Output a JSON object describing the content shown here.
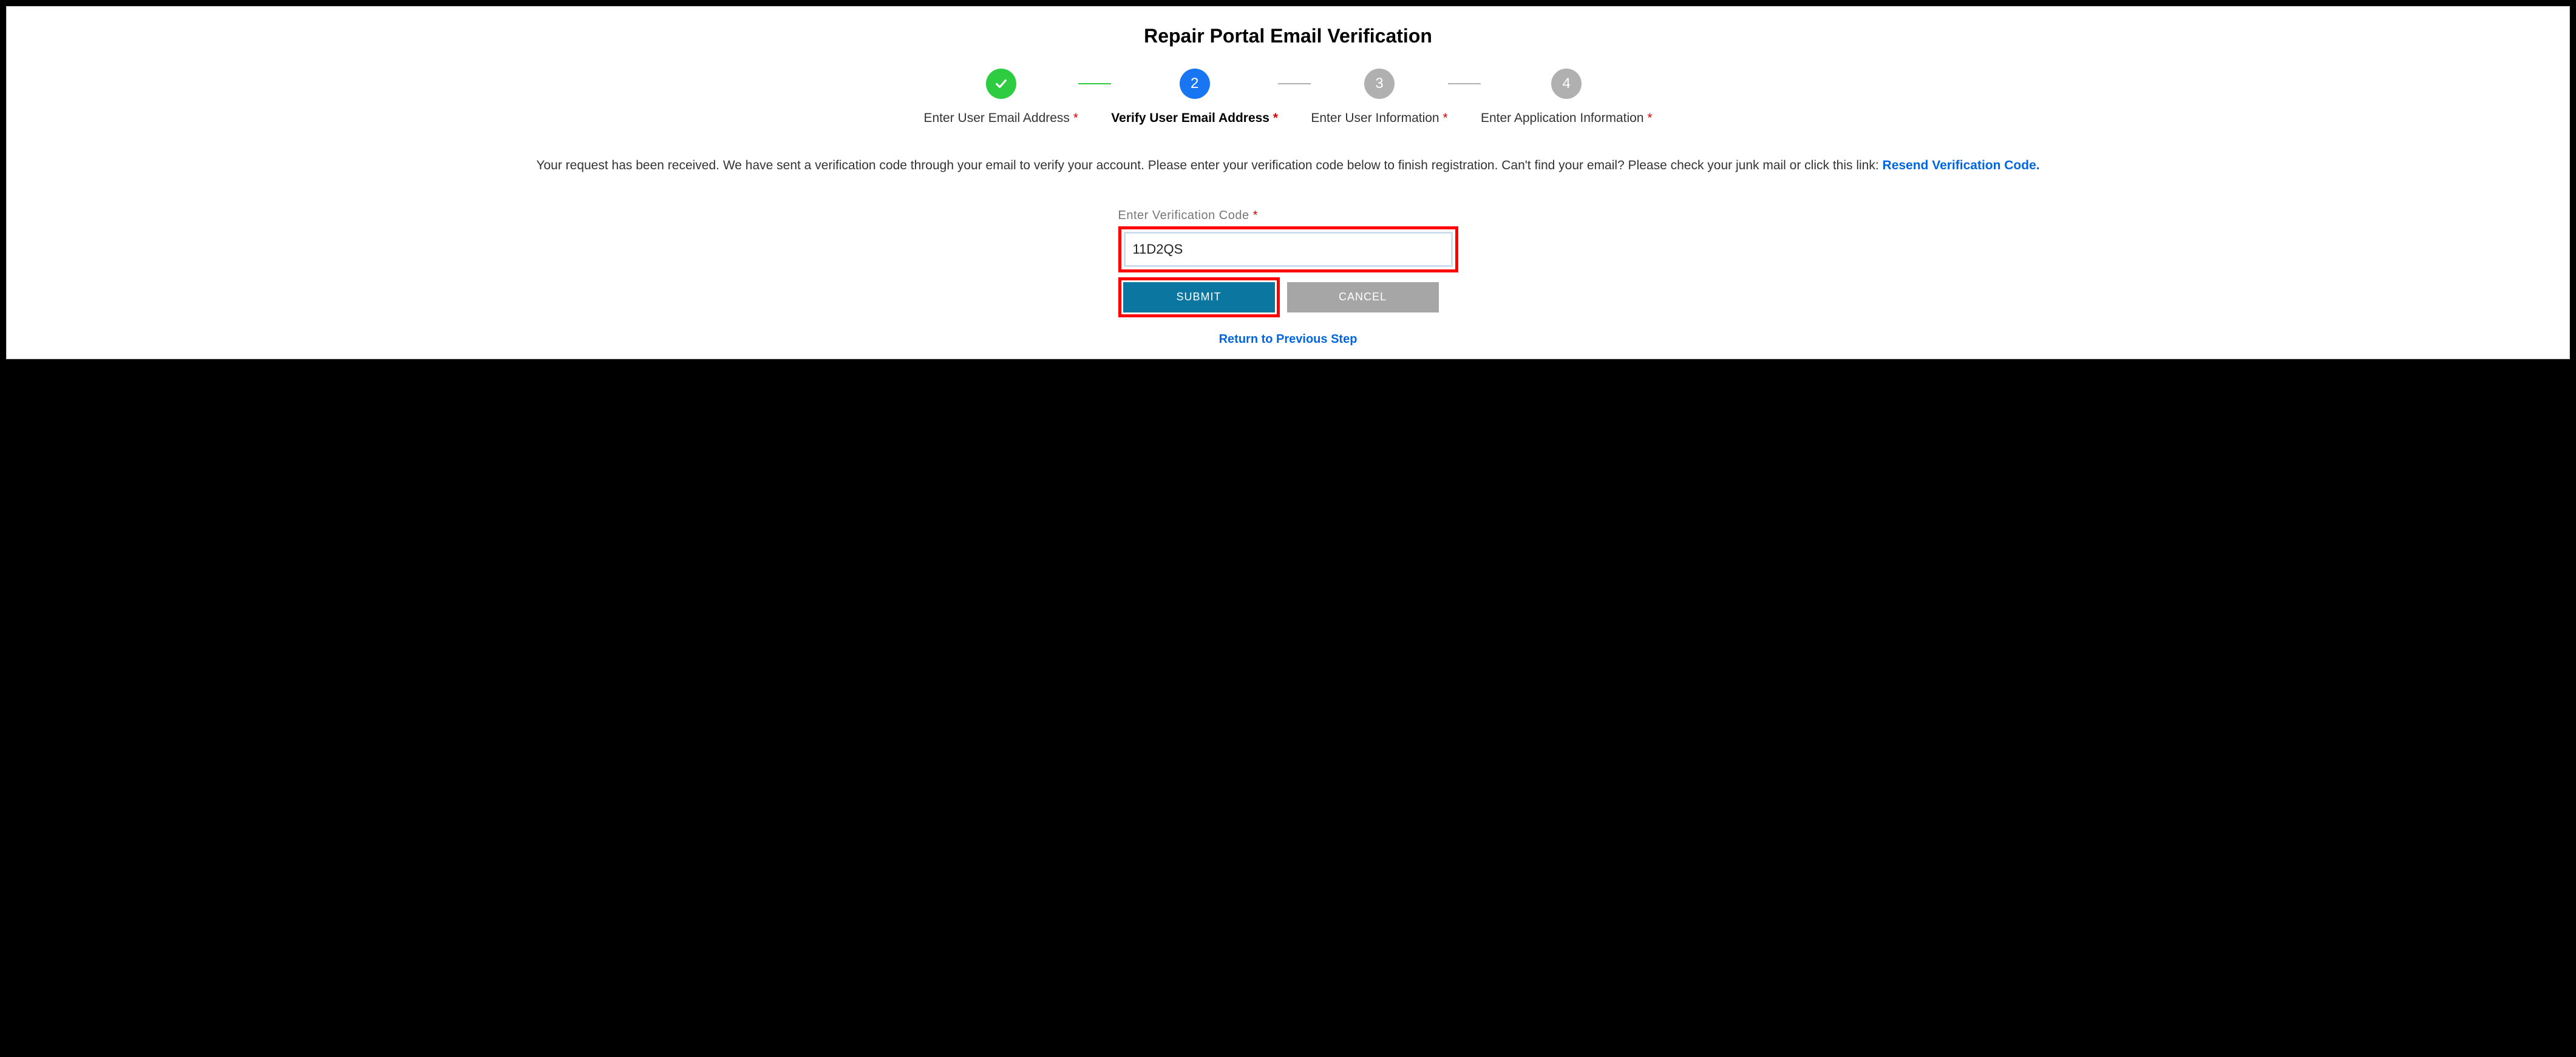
{
  "title": "Repair Portal Email Verification",
  "steps": [
    {
      "label": "Enter User Email Address ",
      "state": "done"
    },
    {
      "label": "Verify User Email Address ",
      "state": "active",
      "num": "2"
    },
    {
      "label": "Enter User Information ",
      "state": "pending",
      "num": "3"
    },
    {
      "label": "Enter Application Information ",
      "state": "pending",
      "num": "4"
    }
  ],
  "required_mark": "*",
  "instructions_part1": "Your request has been received. We have sent a verification code through your email to verify your account. Please enter your verification code below to finish registration. Can't find your email? Please check your junk mail or click this link: ",
  "resend_link": "Resend Verification Code.",
  "form": {
    "code_label": "Enter Verification Code ",
    "code_value": "11D2QS",
    "submit_label": "SUBMIT",
    "cancel_label": "CANCEL"
  },
  "return_link": "Return to Previous Step"
}
